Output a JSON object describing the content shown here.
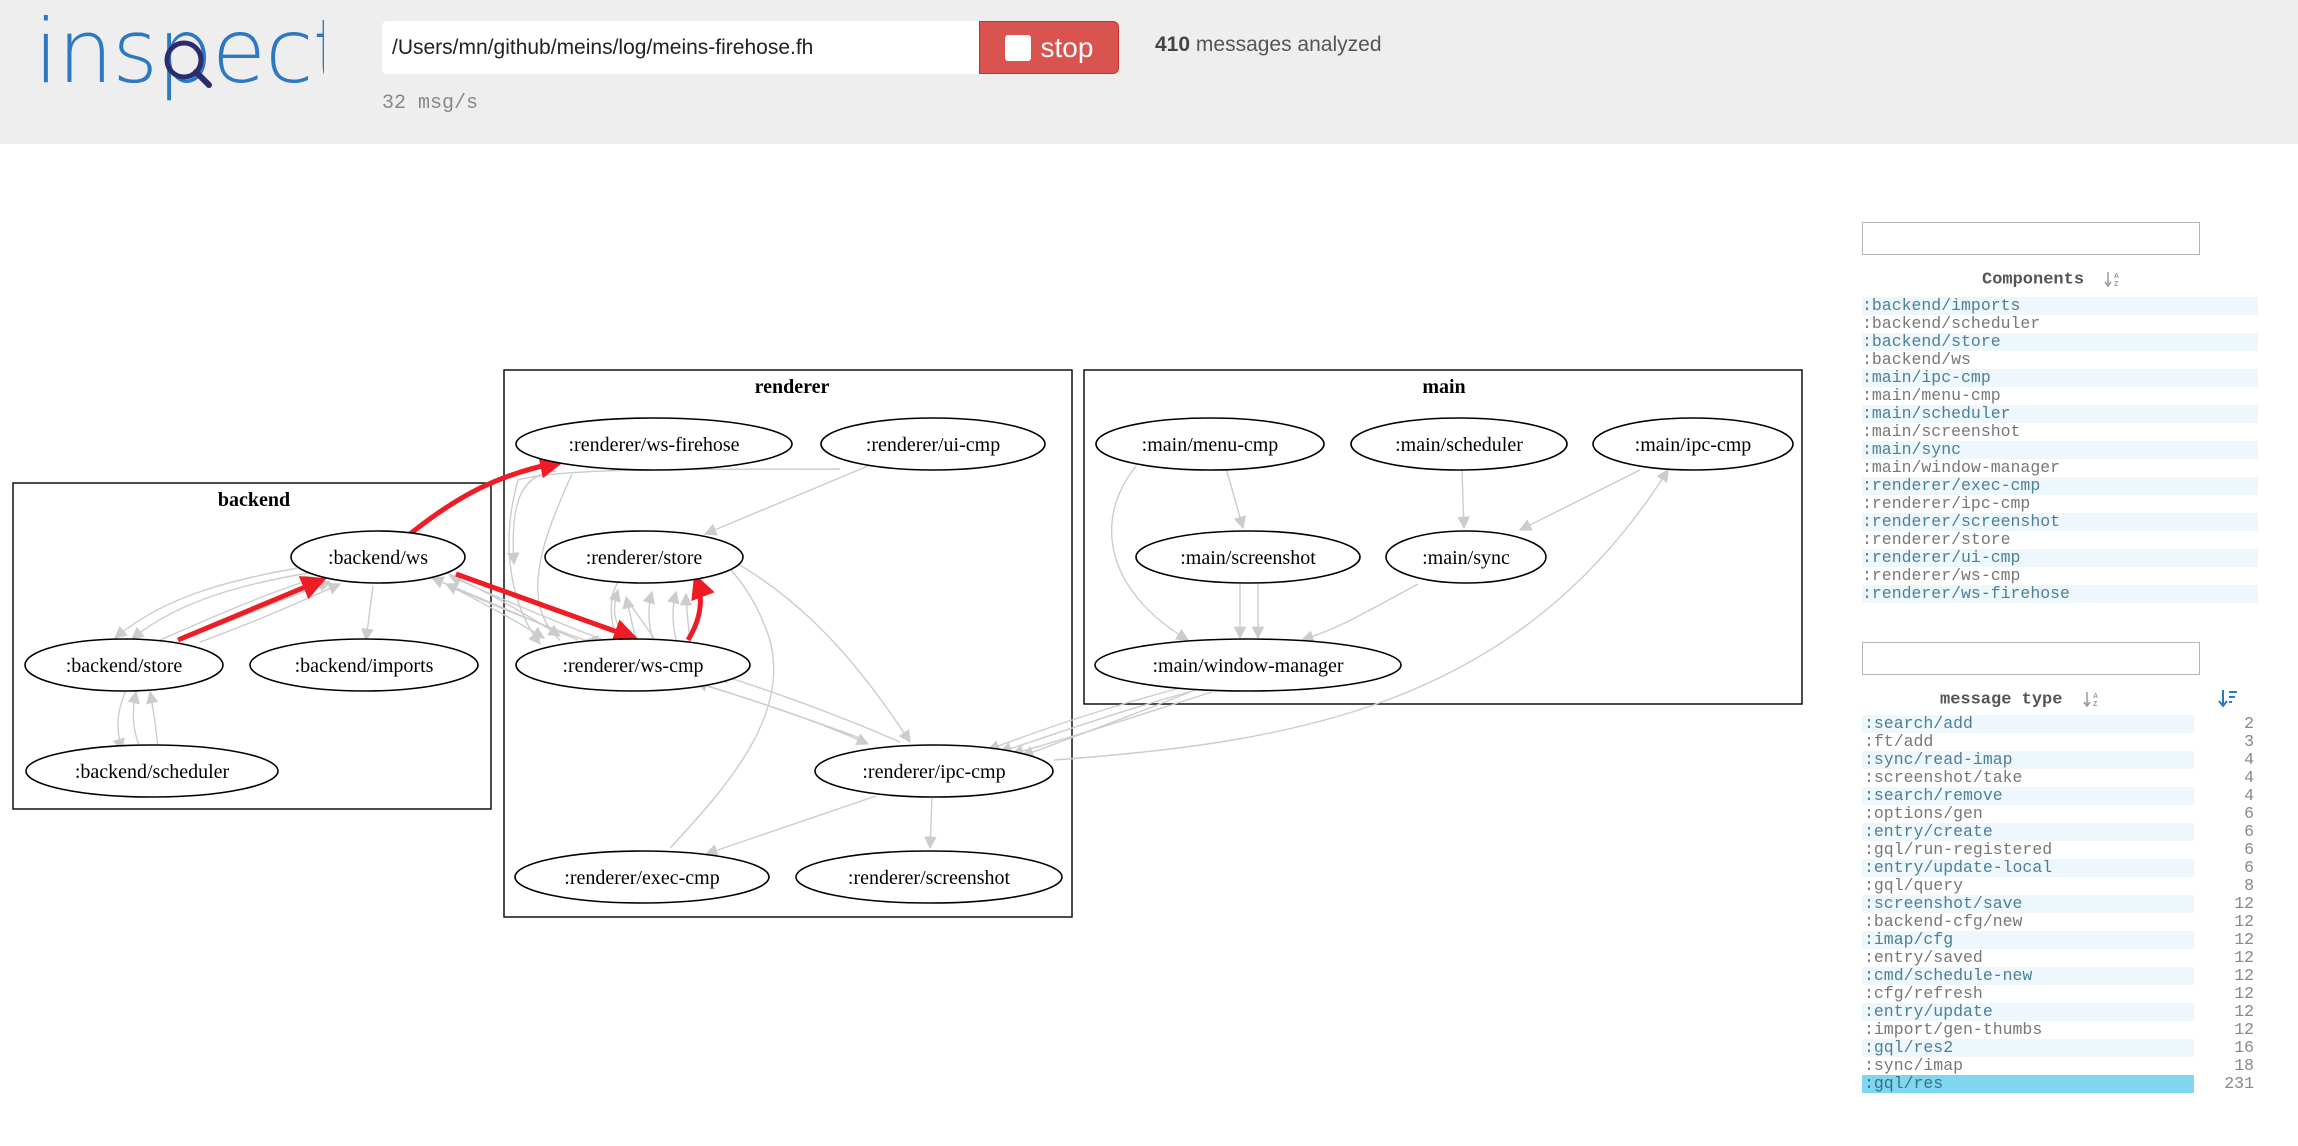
{
  "app": {
    "logo_text": "inspect",
    "brand_color": "#2b78c4",
    "accent_color": "#d9534f"
  },
  "controls": {
    "path_value": "/Users/mn/github/meins/log/meins-firehose.fh",
    "stop_label": "stop",
    "stop_icon": "stop-square-icon"
  },
  "stats": {
    "messages_count": "410",
    "messages_text": "messages analyzed",
    "rate": "32 msg/s"
  },
  "graph": {
    "clusters": [
      {
        "id": "backend",
        "label": "backend"
      },
      {
        "id": "renderer",
        "label": "renderer"
      },
      {
        "id": "main",
        "label": "main"
      }
    ],
    "nodes": [
      {
        "id": "backend_ws",
        "label": ":backend/ws"
      },
      {
        "id": "backend_store",
        "label": ":backend/store"
      },
      {
        "id": "backend_imports",
        "label": ":backend/imports"
      },
      {
        "id": "backend_scheduler",
        "label": ":backend/scheduler"
      },
      {
        "id": "renderer_ws_firehose",
        "label": ":renderer/ws-firehose"
      },
      {
        "id": "renderer_ui_cmp",
        "label": ":renderer/ui-cmp"
      },
      {
        "id": "renderer_store",
        "label": ":renderer/store"
      },
      {
        "id": "renderer_ws_cmp",
        "label": ":renderer/ws-cmp"
      },
      {
        "id": "renderer_ipc_cmp",
        "label": ":renderer/ipc-cmp"
      },
      {
        "id": "renderer_exec_cmp",
        "label": ":renderer/exec-cmp"
      },
      {
        "id": "renderer_screenshot",
        "label": ":renderer/screenshot"
      },
      {
        "id": "main_menu_cmp",
        "label": ":main/menu-cmp"
      },
      {
        "id": "main_scheduler",
        "label": ":main/scheduler"
      },
      {
        "id": "main_ipc_cmp",
        "label": ":main/ipc-cmp"
      },
      {
        "id": "main_screenshot",
        "label": ":main/screenshot"
      },
      {
        "id": "main_sync",
        "label": ":main/sync"
      },
      {
        "id": "main_window_manager",
        "label": ":main/window-manager"
      }
    ],
    "highlight_color": "#ee1c25",
    "edge_color": "#cccccc"
  },
  "components": {
    "header": "Components",
    "sort_icon": "sort-alpha-icon",
    "items": [
      ":backend/imports",
      ":backend/scheduler",
      ":backend/store",
      ":backend/ws",
      ":main/ipc-cmp",
      ":main/menu-cmp",
      ":main/scheduler",
      ":main/screenshot",
      ":main/sync",
      ":main/window-manager",
      ":renderer/exec-cmp",
      ":renderer/ipc-cmp",
      ":renderer/screenshot",
      ":renderer/store",
      ":renderer/ui-cmp",
      ":renderer/ws-cmp",
      ":renderer/ws-firehose"
    ]
  },
  "message_types": {
    "header": "message type",
    "sort_icon": "sort-alpha-icon",
    "count_sort_icon": "sort-count-icon",
    "selected": ":gql/res",
    "items": [
      {
        "name": ":search/add",
        "count": "2"
      },
      {
        "name": ":ft/add",
        "count": "3"
      },
      {
        "name": ":sync/read-imap",
        "count": "4"
      },
      {
        "name": ":screenshot/take",
        "count": "4"
      },
      {
        "name": ":search/remove",
        "count": "4"
      },
      {
        "name": ":options/gen",
        "count": "6"
      },
      {
        "name": ":entry/create",
        "count": "6"
      },
      {
        "name": ":gql/run-registered",
        "count": "6"
      },
      {
        "name": ":entry/update-local",
        "count": "6"
      },
      {
        "name": ":gql/query",
        "count": "8"
      },
      {
        "name": ":screenshot/save",
        "count": "12"
      },
      {
        "name": ":backend-cfg/new",
        "count": "12"
      },
      {
        "name": ":imap/cfg",
        "count": "12"
      },
      {
        "name": ":entry/saved",
        "count": "12"
      },
      {
        "name": ":cmd/schedule-new",
        "count": "12"
      },
      {
        "name": ":cfg/refresh",
        "count": "12"
      },
      {
        "name": ":entry/update",
        "count": "12"
      },
      {
        "name": ":import/gen-thumbs",
        "count": "12"
      },
      {
        "name": ":gql/res2",
        "count": "16"
      },
      {
        "name": ":sync/imap",
        "count": "18"
      },
      {
        "name": ":gql/res",
        "count": "231"
      }
    ]
  }
}
